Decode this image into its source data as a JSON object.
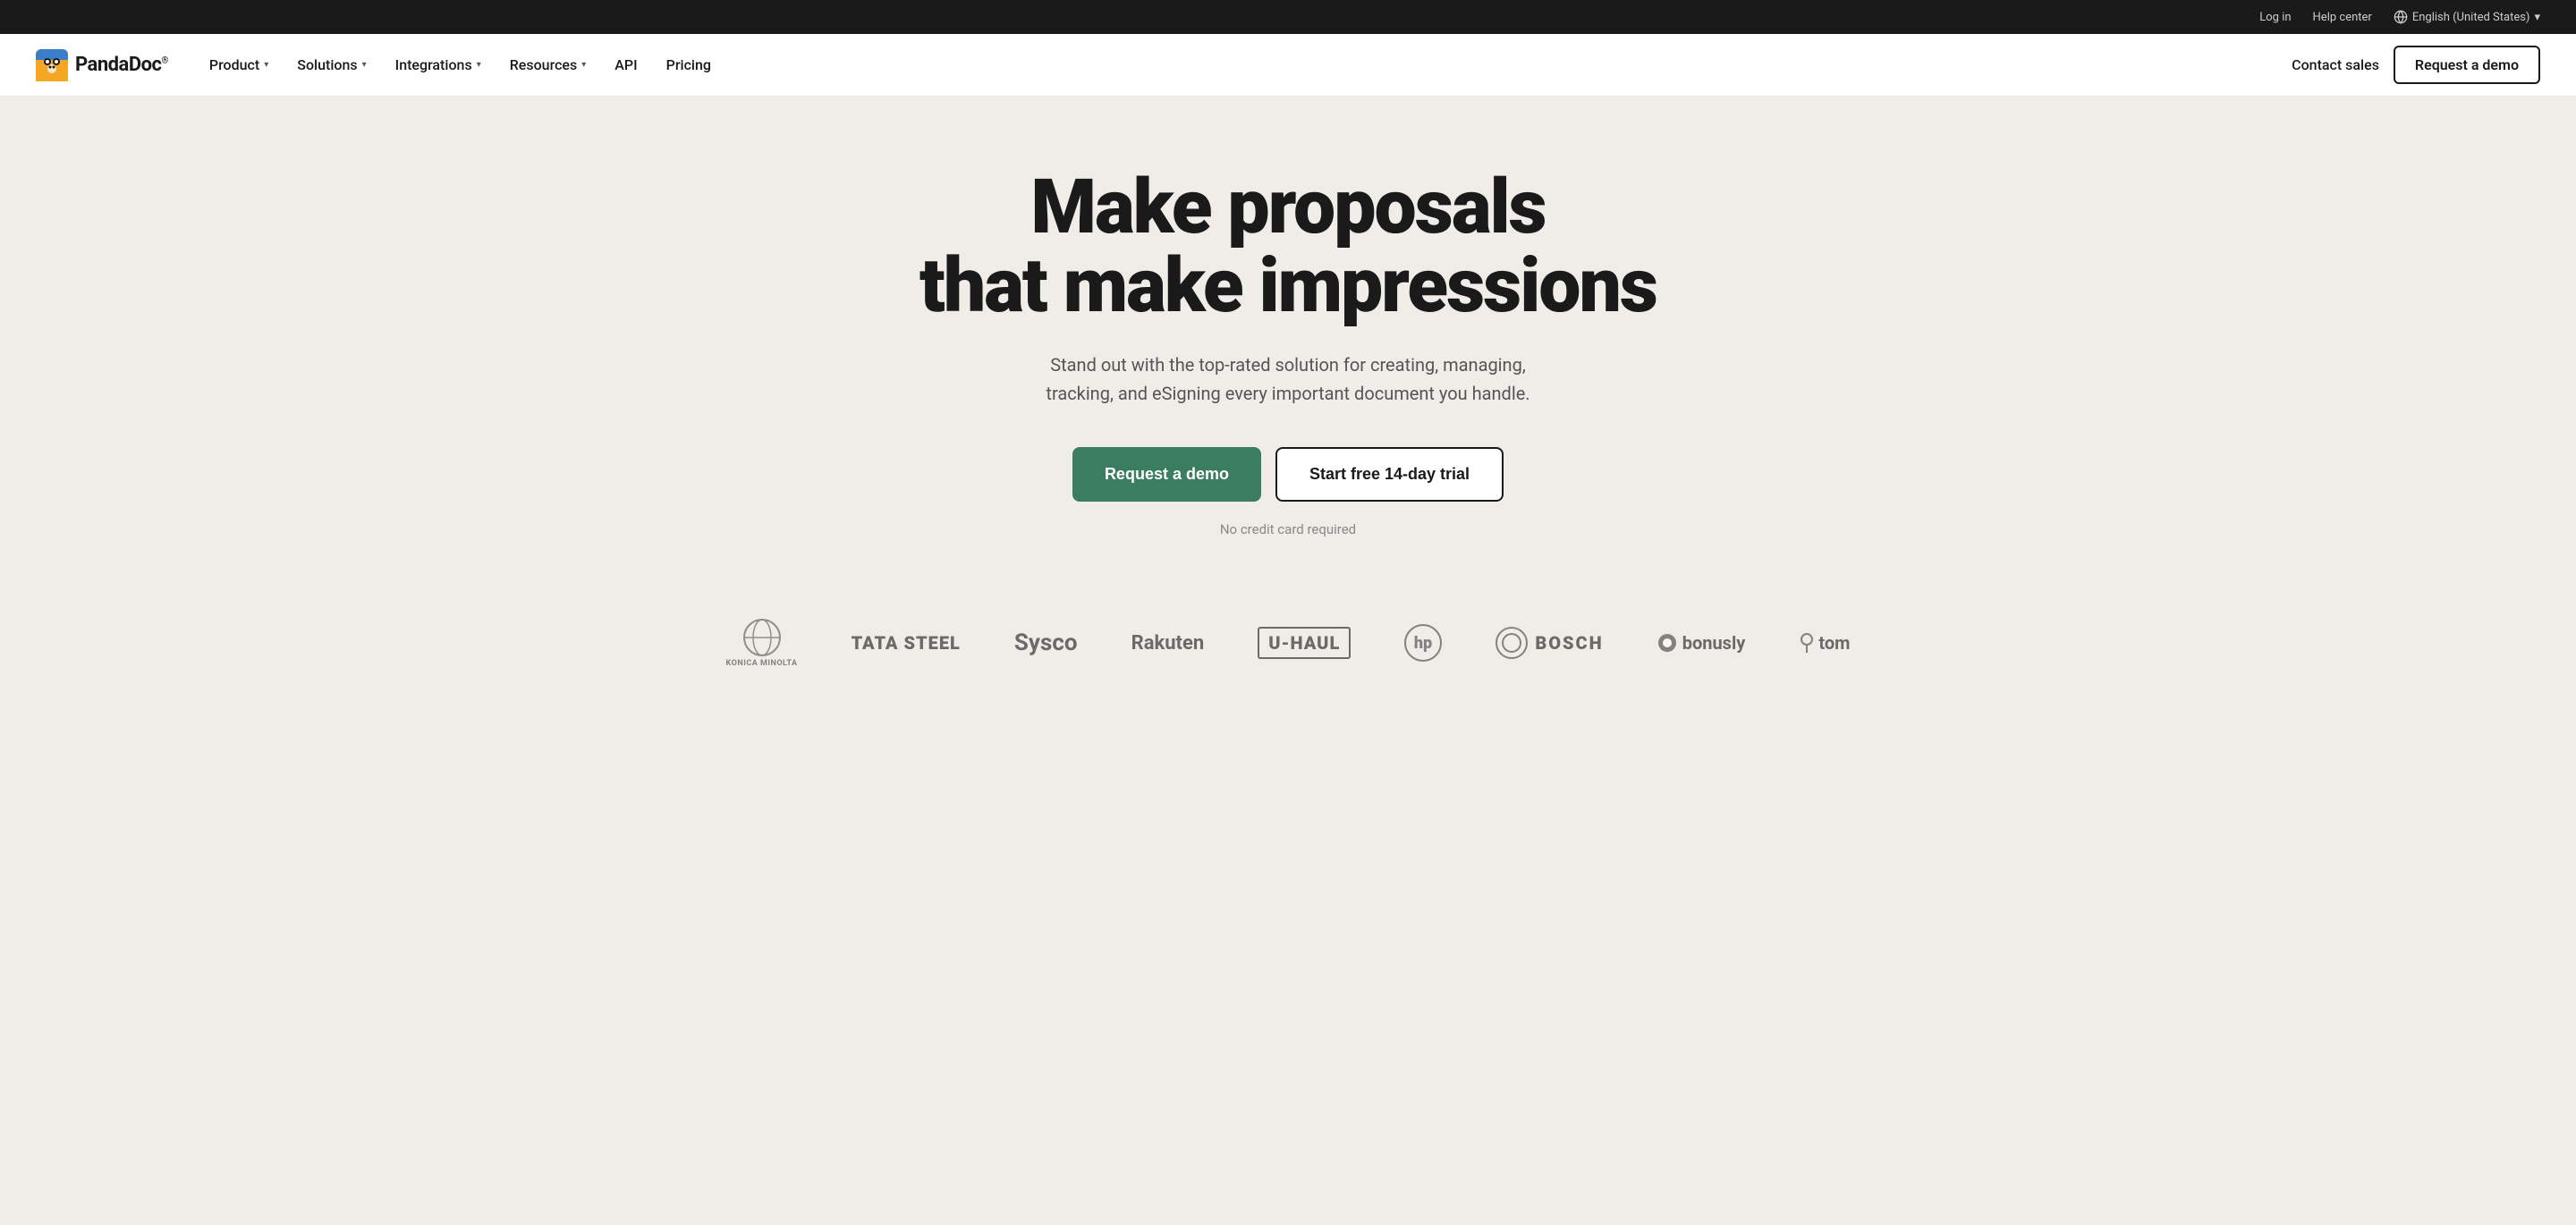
{
  "topbar": {
    "login_label": "Log in",
    "help_label": "Help center",
    "language_label": "English (United States)",
    "language_chevron": "▾"
  },
  "navbar": {
    "logo_text": "PandaDoc",
    "logo_reg": "®",
    "nav_items": [
      {
        "label": "Product",
        "has_dropdown": true
      },
      {
        "label": "Solutions",
        "has_dropdown": true
      },
      {
        "label": "Integrations",
        "has_dropdown": true
      },
      {
        "label": "Resources",
        "has_dropdown": true
      },
      {
        "label": "API",
        "has_dropdown": false
      },
      {
        "label": "Pricing",
        "has_dropdown": false
      }
    ],
    "contact_sales": "Contact sales",
    "request_demo": "Request a demo"
  },
  "hero": {
    "title_line1": "Make proposals",
    "title_line2": "that make impressions",
    "subtitle": "Stand out with the top-rated solution for creating, managing, tracking, and eSigning every important document you handle.",
    "btn_primary": "Request a demo",
    "btn_secondary": "Start free 14-day trial",
    "no_cc": "No credit card required"
  },
  "logos": [
    {
      "name": "Konica Minolta",
      "style": "konica"
    },
    {
      "name": "TATA STEEL",
      "style": "text"
    },
    {
      "name": "Sysco",
      "style": "text"
    },
    {
      "name": "Rakuten",
      "style": "text"
    },
    {
      "name": "U-HAUL",
      "style": "text"
    },
    {
      "name": "HP",
      "style": "circle"
    },
    {
      "name": "BOSCH",
      "style": "text"
    },
    {
      "name": "bonusly",
      "style": "text"
    },
    {
      "name": "tom",
      "style": "text"
    }
  ],
  "colors": {
    "topbar_bg": "#1a1a1a",
    "nav_bg": "#ffffff",
    "hero_bg": "#f0ede8",
    "btn_primary_bg": "#3a7d60",
    "btn_secondary_border": "#1a1a1a",
    "text_dark": "#1a1a1a",
    "text_muted": "#888888"
  }
}
